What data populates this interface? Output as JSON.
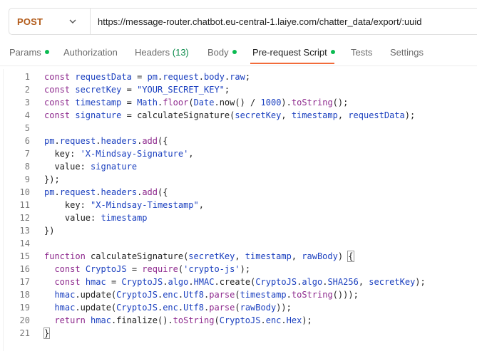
{
  "request": {
    "method": "POST",
    "url": "https://message-router.chatbot.eu-central-1.laiye.com/chatter_data/export/:uuid"
  },
  "tabs": [
    {
      "label": "Params",
      "dot": true
    },
    {
      "label": "Authorization"
    },
    {
      "label": "Headers",
      "count": "(13)"
    },
    {
      "label": "Body",
      "dot": true
    },
    {
      "label": "Pre-request Script",
      "dot": true,
      "active": true
    },
    {
      "label": "Tests"
    },
    {
      "label": "Settings"
    }
  ],
  "editor": {
    "lines": [
      {
        "n": "1",
        "html": "<span class=\"kw\">const</span> <span class=\"var\">requestData</span> = <span class=\"var\">pm</span>.<span class=\"var\">request</span>.<span class=\"var\">body</span>.<span class=\"var\">raw</span>;"
      },
      {
        "n": "2",
        "html": "<span class=\"kw\">const</span> <span class=\"var\">secretKey</span> = <span class=\"str\">\"YOUR_SECRET_KEY\"</span>;"
      },
      {
        "n": "3",
        "html": "<span class=\"kw\">const</span> <span class=\"var\">timestamp</span> = <span class=\"var\">Math</span>.<span class=\"fn\">floor</span>(<span class=\"var\">Date</span>.now() / <span class=\"num\">1000</span>).<span class=\"fn\">toString</span>();"
      },
      {
        "n": "4",
        "html": "<span class=\"kw\">const</span> <span class=\"var\">signature</span> = calculateSignature(<span class=\"var\">secretKey</span>, <span class=\"var\">timestamp</span>, <span class=\"var\">requestData</span>);"
      },
      {
        "n": "5",
        "html": ""
      },
      {
        "n": "6",
        "html": "<span class=\"var\">pm</span>.<span class=\"var\">request</span>.<span class=\"var\">headers</span>.<span class=\"fn\">add</span>({"
      },
      {
        "n": "7",
        "html": "  key: <span class=\"str\">'X-Mindsay-Signature'</span>,"
      },
      {
        "n": "8",
        "html": "  value: <span class=\"var\">signature</span>"
      },
      {
        "n": "9",
        "html": "});"
      },
      {
        "n": "10",
        "html": "<span class=\"var\">pm</span>.<span class=\"var\">request</span>.<span class=\"var\">headers</span>.<span class=\"fn\">add</span>({"
      },
      {
        "n": "11",
        "html": "    key: <span class=\"str\">\"X-Mindsay-Timestamp\"</span>,"
      },
      {
        "n": "12",
        "html": "    value: <span class=\"var\">timestamp</span>"
      },
      {
        "n": "13",
        "html": "})"
      },
      {
        "n": "14",
        "html": ""
      },
      {
        "n": "15",
        "html": "<span class=\"kw\">function</span> calculateSignature(<span class=\"var\">secretKey</span>, <span class=\"var\">timestamp</span>, <span class=\"var\">rawBody</span>) <span class=\"brk-hl\">{</span>"
      },
      {
        "n": "16",
        "html": "  <span class=\"kw\">const</span> <span class=\"var\">CryptoJS</span> = <span class=\"fn\">require</span>(<span class=\"str\">'crypto-js'</span>);"
      },
      {
        "n": "17",
        "html": "  <span class=\"kw\">const</span> <span class=\"var\">hmac</span> = <span class=\"var\">CryptoJS</span>.<span class=\"var\">algo</span>.<span class=\"var\">HMAC</span>.create(<span class=\"var\">CryptoJS</span>.<span class=\"var\">algo</span>.<span class=\"var\">SHA256</span>, <span class=\"var\">secretKey</span>);"
      },
      {
        "n": "18",
        "html": "  <span class=\"var\">hmac</span>.update(<span class=\"var\">CryptoJS</span>.<span class=\"var\">enc</span>.<span class=\"var\">Utf8</span>.<span class=\"fn\">parse</span>(<span class=\"var\">timestamp</span>.<span class=\"fn\">toString</span>()));"
      },
      {
        "n": "19",
        "html": "  <span class=\"var\">hmac</span>.update(<span class=\"var\">CryptoJS</span>.<span class=\"var\">enc</span>.<span class=\"var\">Utf8</span>.<span class=\"fn\">parse</span>(<span class=\"var\">rawBody</span>));"
      },
      {
        "n": "20",
        "html": "  <span class=\"kw\">return</span> <span class=\"var\">hmac</span>.finalize().<span class=\"fn\">toString</span>(<span class=\"var\">CryptoJS</span>.<span class=\"var\">enc</span>.<span class=\"var\">Hex</span>);"
      },
      {
        "n": "21",
        "html": "<span class=\"brk-hl\">}</span>"
      }
    ]
  }
}
